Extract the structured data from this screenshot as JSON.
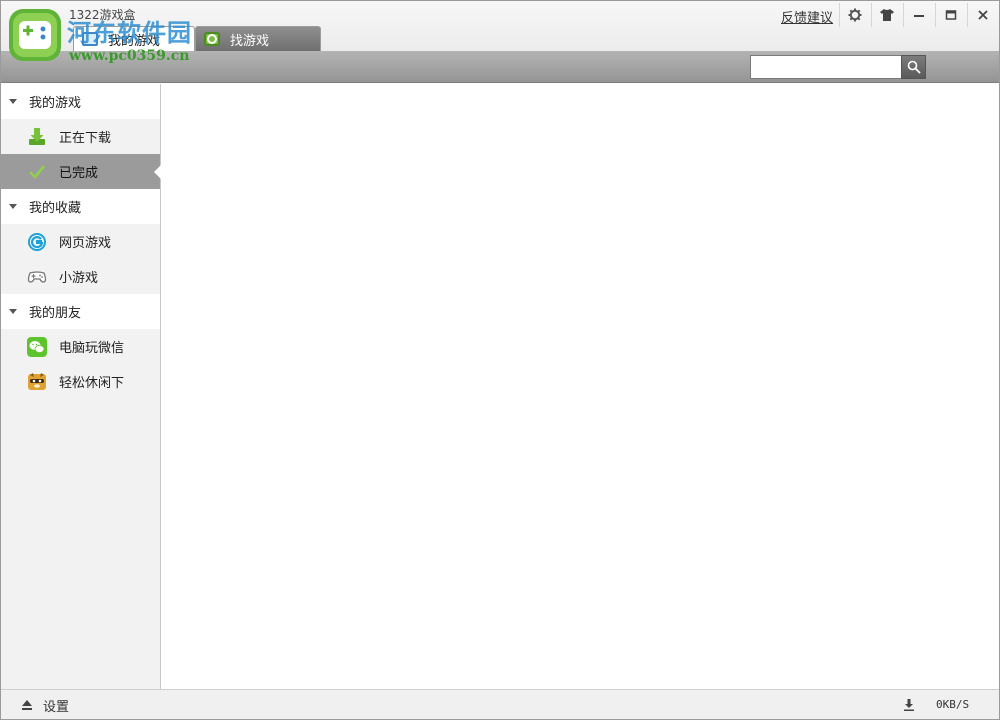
{
  "window": {
    "title": "1322游戏盒"
  },
  "watermark": {
    "name": "河东软件园",
    "url": "www.pc0359.cn"
  },
  "tabs": [
    {
      "label": "我的游戏",
      "active": true
    },
    {
      "label": "找游戏",
      "active": false
    }
  ],
  "titlebar": {
    "feedback_label": "反馈建议",
    "buttons": [
      "gear-icon",
      "shirt-icon",
      "minimize-icon",
      "maximize-icon",
      "close-icon"
    ]
  },
  "search": {
    "placeholder": "",
    "value": ""
  },
  "sidebar": {
    "sections": [
      {
        "title": "我的游戏",
        "items": [
          {
            "label": "正在下载",
            "icon": "download-icon",
            "selected": false
          },
          {
            "label": "已完成",
            "icon": "checkmark-icon",
            "selected": true
          }
        ]
      },
      {
        "title": "我的收藏",
        "items": [
          {
            "label": "网页游戏",
            "icon": "web-game-icon",
            "selected": false
          },
          {
            "label": "小游戏",
            "icon": "gamepad-icon",
            "selected": false
          }
        ]
      },
      {
        "title": "我的朋友",
        "items": [
          {
            "label": "电脑玩微信",
            "icon": "wechat-icon",
            "selected": false
          },
          {
            "label": "轻松休闲下",
            "icon": "raccoon-icon",
            "selected": false
          }
        ]
      }
    ]
  },
  "statusbar": {
    "settings_label": "设置",
    "speed": "0KB/S"
  },
  "colors": {
    "accent_blue": "#3f86c9",
    "accent_green": "#7ac142",
    "selected_bg": "#9b9b9b"
  }
}
